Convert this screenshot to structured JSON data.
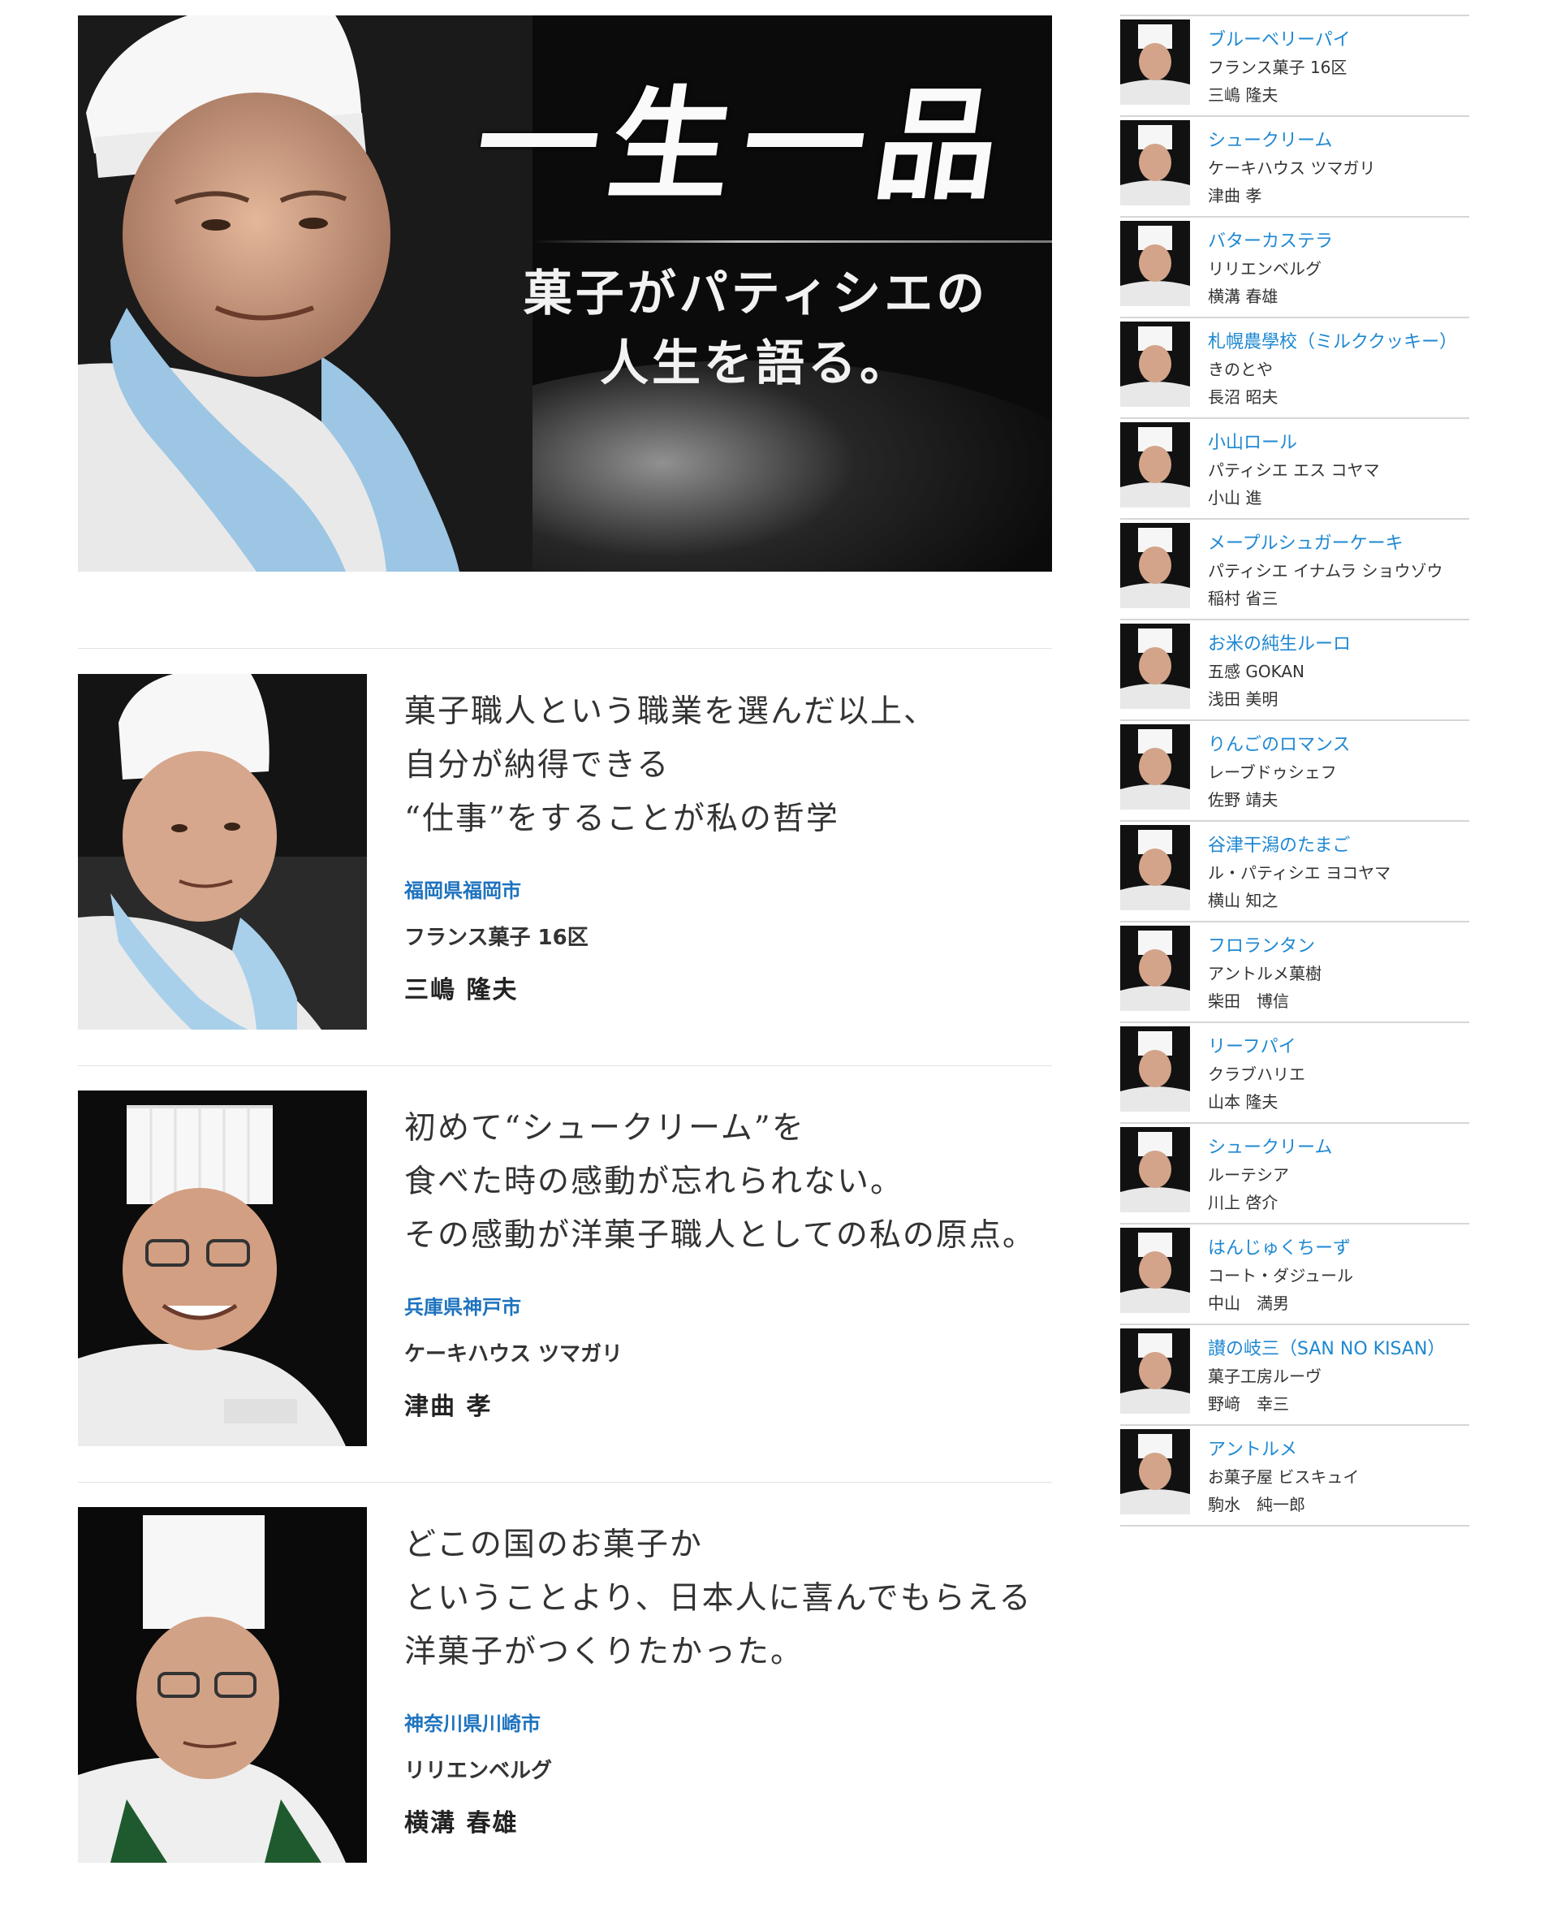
{
  "hero": {
    "title": "一生一品",
    "subtitle_line1": "菓子がパティシエの",
    "subtitle_line2": "人生を語る。"
  },
  "entries": [
    {
      "quote": [
        "菓子職人という職業を選んだ以上、",
        "自分が納得できる",
        "“仕事”をすることが私の哲学"
      ],
      "location": "福岡県福岡市",
      "shop": "フランス菓子 16区",
      "name": "三嶋 隆夫",
      "scarf": "#a9d0ea"
    },
    {
      "quote": [
        "初めて“シュークリーム”を",
        "食べた時の感動が忘れられない。",
        "その感動が洋菓子職人としての私の原点。"
      ],
      "location": "兵庫県神戸市",
      "shop": "ケーキハウス ツマガリ",
      "name": "津曲 孝",
      "scarf": "#ffffff"
    },
    {
      "quote": [
        "どこの国のお菓子か",
        "ということより、日本人に喜んでもらえる",
        "洋菓子がつくりたかった。"
      ],
      "location": "神奈川県川崎市",
      "shop": "リリエンベルグ",
      "name": "横溝 春雄",
      "scarf": "#1f5a2e"
    }
  ],
  "sidebar": [
    {
      "title": "ブルーベリーパイ",
      "shop": "フランス菓子 16区",
      "name": "三嶋 隆夫"
    },
    {
      "title": "シュークリーム",
      "shop": "ケーキハウス ツマガリ",
      "name": "津曲 孝"
    },
    {
      "title": "バターカステラ",
      "shop": "リリエンベルグ",
      "name": "横溝 春雄"
    },
    {
      "title": "札幌農學校（ミルククッキー）",
      "shop": "きのとや",
      "name": "長沼 昭夫"
    },
    {
      "title": "小山ロール",
      "shop": "パティシエ エス コヤマ",
      "name": "小山 進"
    },
    {
      "title": "メープルシュガーケーキ",
      "shop": "パティシエ イナムラ ショウゾウ",
      "name": "稲村 省三"
    },
    {
      "title": "お米の純生ルーロ",
      "shop": "五感 GOKAN",
      "name": "浅田 美明"
    },
    {
      "title": "りんごのロマンス",
      "shop": "レーブドゥシェフ",
      "name": "佐野 靖夫"
    },
    {
      "title": "谷津干潟のたまご",
      "shop": "ル・パティシエ ヨコヤマ",
      "name": "横山 知之"
    },
    {
      "title": "フロランタン",
      "shop": "アントルメ菓樹",
      "name": "柴田　博信"
    },
    {
      "title": "リーフパイ",
      "shop": "クラブハリエ",
      "name": "山本 隆夫"
    },
    {
      "title": "シュークリーム",
      "shop": "ルーテシア",
      "name": "川上 啓介"
    },
    {
      "title": "はんじゅくちーず",
      "shop": "コート・ダジュール",
      "name": "中山　満男"
    },
    {
      "title": "讃の岐三（SAN NO KISAN）",
      "shop": "菓子工房ルーヴ",
      "name": "野﨑　幸三"
    },
    {
      "title": "アントルメ",
      "shop": "お菓子屋 ビスキュイ",
      "name": "駒水　純一郎"
    }
  ]
}
